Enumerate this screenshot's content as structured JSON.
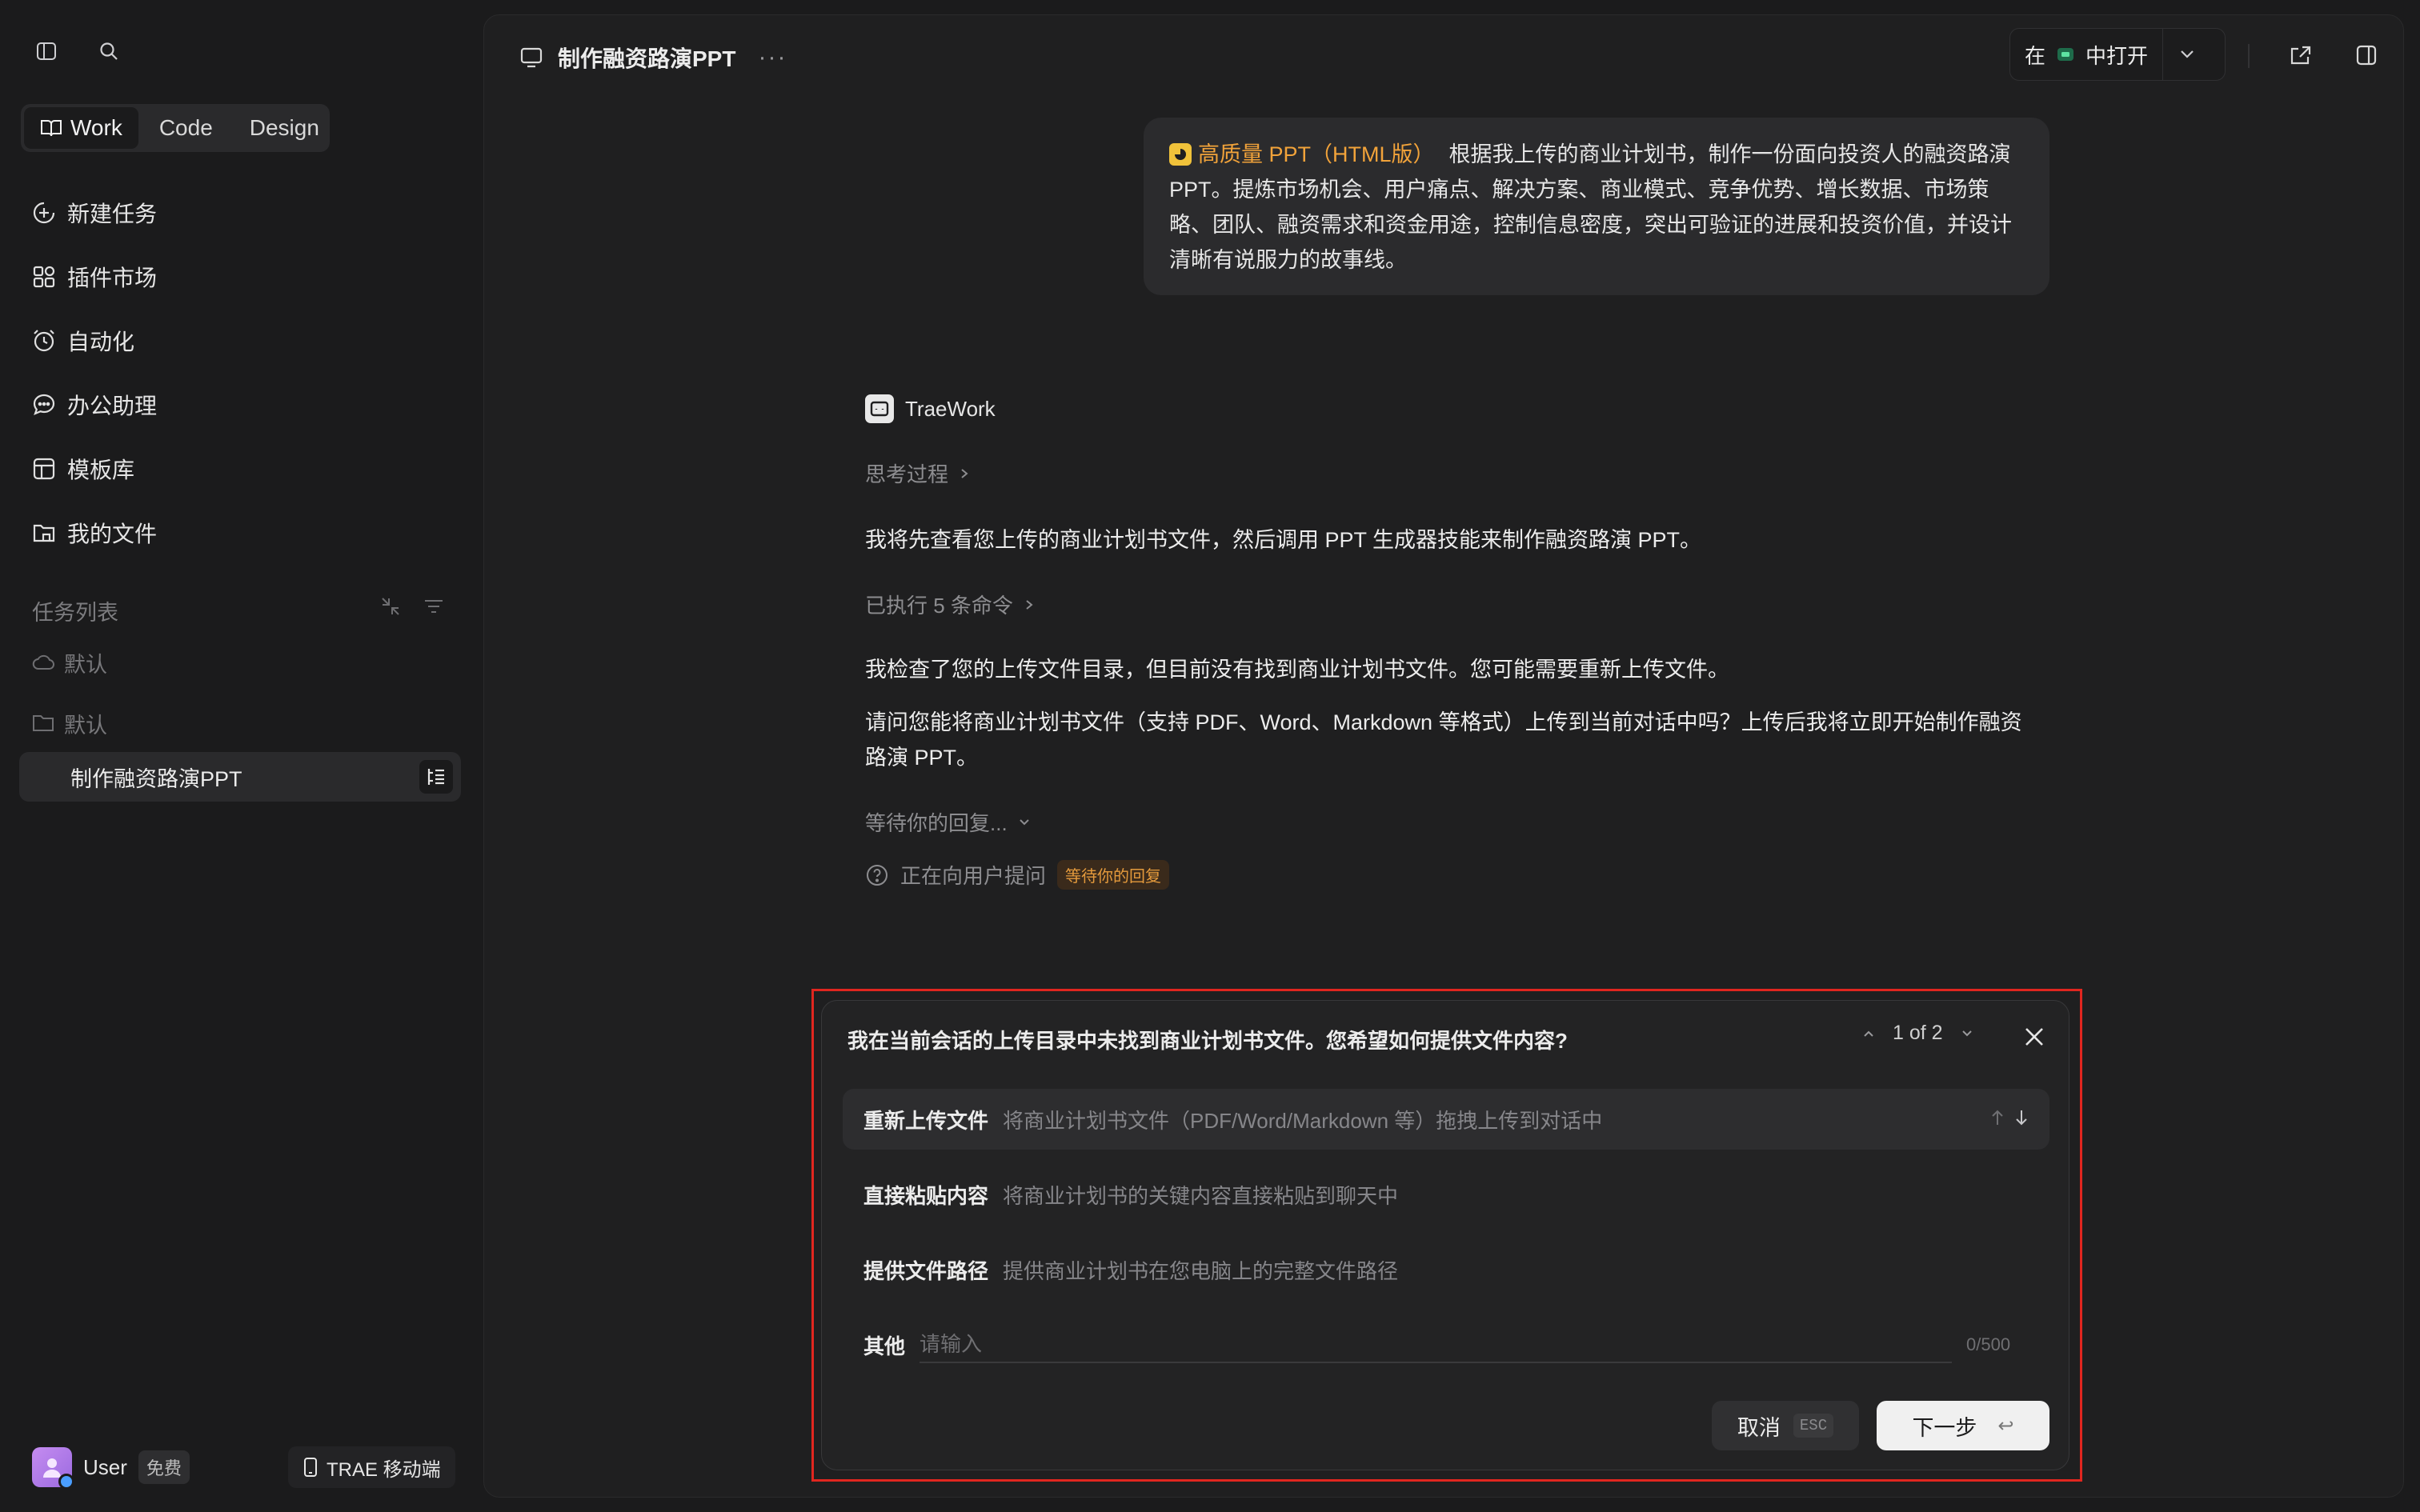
{
  "sidebar": {
    "modes": [
      {
        "label": "Work",
        "active": true
      },
      {
        "label": "Code",
        "active": false
      },
      {
        "label": "Design",
        "active": false
      }
    ],
    "nav": [
      {
        "label": "新建任务",
        "icon": "plus-circle-icon"
      },
      {
        "label": "插件市场",
        "icon": "plugin-grid-icon"
      },
      {
        "label": "自动化",
        "icon": "alarm-clock-icon"
      },
      {
        "label": "办公助理",
        "icon": "chat-bubble-icon"
      },
      {
        "label": "模板库",
        "icon": "template-icon"
      },
      {
        "label": "我的文件",
        "icon": "folder-icon"
      }
    ],
    "section_label": "任务列表",
    "groups": [
      {
        "label": "默认",
        "icon": "cloud-icon"
      },
      {
        "label": "默认",
        "icon": "folder-icon"
      }
    ],
    "active_task": "制作融资路演PPT",
    "user": {
      "name": "User",
      "plan": "免费"
    },
    "mobile_button": "TRAE 移动端"
  },
  "header": {
    "title": "制作融资路演PPT",
    "more": "···",
    "open_in": {
      "prefix": "在",
      "suffix": "中打开"
    }
  },
  "conversation": {
    "user_message": {
      "tag": "高质量 PPT（HTML版）",
      "text": "根据我上传的商业计划书，制作一份面向投资人的融资路演 PPT。提炼市场机会、用户痛点、解决方案、商业模式、竞争优势、增长数据、市场策略、团队、融资需求和资金用途，控制信息密度，突出可验证的进展和投资价值，并设计清晰有说服力的故事线。"
    },
    "assistant": {
      "name": "TraeWork",
      "thinking": "思考过程",
      "para1": "我将先查看您上传的商业计划书文件，然后调用 PPT 生成器技能来制作融资路演 PPT。",
      "executed": "已执行 5 条命令",
      "para2": "我检查了您的上传文件目录，但目前没有找到商业计划书文件。您可能需要重新上传文件。",
      "para3": "请问您能将商业计划书文件（支持 PDF、Word、Markdown 等格式）上传到当前对话中吗？上传后我将立即开始制作融资路演 PPT。",
      "waiting": "等待你的回复...",
      "asking": "正在向用户提问",
      "asking_badge": "等待你的回复"
    }
  },
  "question_card": {
    "question": "我在当前会话的上传目录中未找到商业计划书文件。您希望如何提供文件内容?",
    "pager": "1 of 2",
    "options": [
      {
        "title": "重新上传文件",
        "desc": "将商业计划书文件（PDF/Word/Markdown 等）拖拽上传到对话中"
      },
      {
        "title": "直接粘贴内容",
        "desc": "将商业计划书的关键内容直接粘贴到聊天中"
      },
      {
        "title": "提供文件路径",
        "desc": "提供商业计划书在您电脑上的完整文件路径"
      }
    ],
    "other": {
      "label": "其他",
      "placeholder": "请输入",
      "value": "",
      "counter": "0/500"
    },
    "cancel": {
      "label": "取消",
      "shortcut": "ESC"
    },
    "next": {
      "label": "下一步",
      "shortcut": "↩"
    }
  }
}
